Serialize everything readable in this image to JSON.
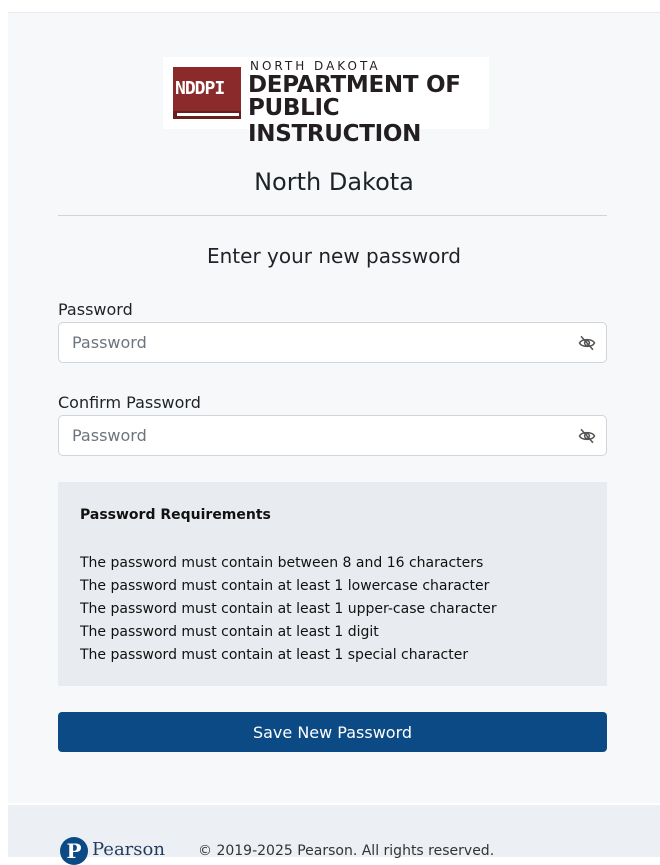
{
  "brand": {
    "logo_abbrev": "NDDPI",
    "logo_line1": "NORTH DAKOTA",
    "logo_line2": "DEPARTMENT OF",
    "logo_line3": "PUBLIC INSTRUCTION",
    "book_color": "#8b2a2a"
  },
  "header": {
    "state_name": "North Dakota"
  },
  "form": {
    "title": "Enter your new password",
    "password": {
      "label": "Password",
      "placeholder": "Password",
      "value": "",
      "toggle_icon": "eye-slash-icon"
    },
    "confirm_password": {
      "label": "Confirm Password",
      "placeholder": "Password",
      "value": "",
      "toggle_icon": "eye-slash-icon"
    },
    "submit_label": "Save New Password"
  },
  "requirements": {
    "title": "Password Requirements",
    "items": [
      "The password must contain between 8 and 16 characters",
      "The password must contain at least 1 lowercase character",
      "The password must contain at least 1 upper-case character",
      "The password must contain at least 1 digit",
      "The password must contain at least 1 special character"
    ]
  },
  "footer": {
    "logo_letter": "P",
    "logo_name": "Pearson",
    "copyright": "© 2019-2025 Pearson. All rights reserved."
  },
  "colors": {
    "primary_button": "#0b4a85",
    "card_background": "#f6f8fa",
    "requirements_background": "#e8ebef"
  }
}
